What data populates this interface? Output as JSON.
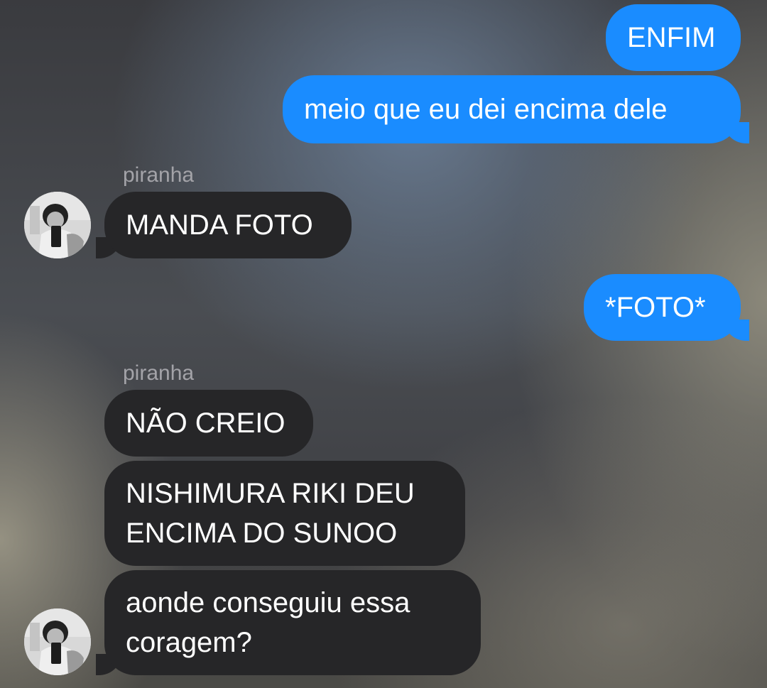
{
  "conversation": {
    "messages": [
      {
        "direction": "sent",
        "text": "ENFIM"
      },
      {
        "direction": "sent",
        "text": "meio que eu dei encima dele"
      },
      {
        "direction": "received",
        "sender": "piranha",
        "text": "MANDA FOTO"
      },
      {
        "direction": "sent",
        "text": "*FOTO*"
      },
      {
        "direction": "received",
        "sender": "piranha",
        "text": "NÃO CREIO"
      },
      {
        "direction": "received",
        "sender": "piranha",
        "text": "NISHIMURA RIKI DEU\nENCIMA DO SUNOO"
      },
      {
        "direction": "received",
        "sender": "piranha",
        "text": "aonde conseguiu essa\ncoragem?"
      }
    ]
  },
  "colors": {
    "sent_bubble": "#1a8cff",
    "received_bubble": "#262628",
    "sender_name": "#a3a3a8"
  }
}
